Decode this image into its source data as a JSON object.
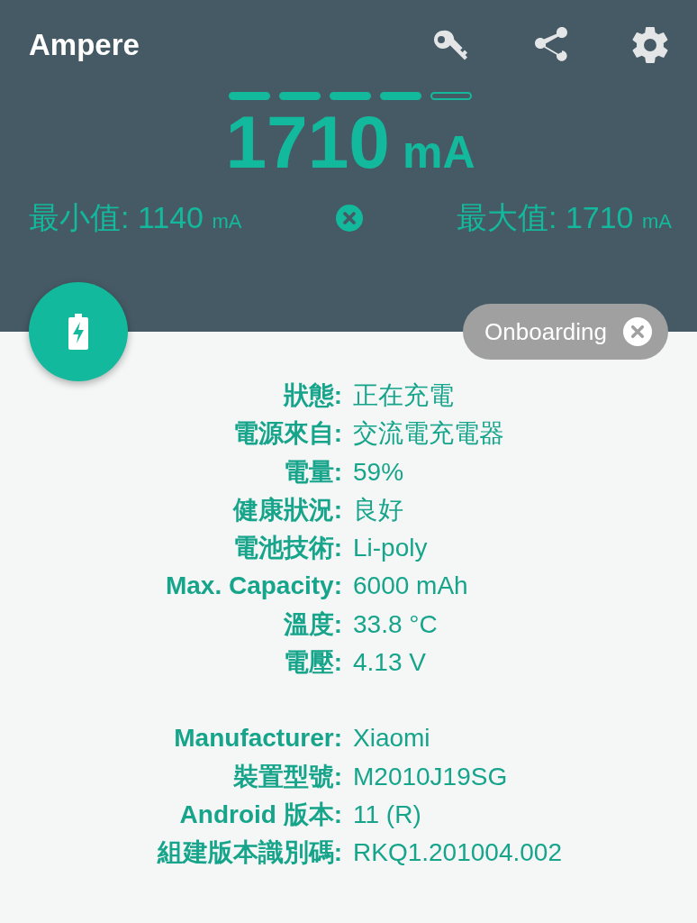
{
  "app_bar": {
    "title": "Ampere"
  },
  "meter": {
    "segments": [
      {
        "on": true
      },
      {
        "on": true
      },
      {
        "on": true
      },
      {
        "on": true
      },
      {
        "on": false
      }
    ],
    "current": "1710",
    "unit": "mA"
  },
  "min": {
    "label": "最小值:",
    "value": "1140",
    "unit": "mA"
  },
  "max": {
    "label": "最大值:",
    "value": "1710",
    "unit": "mA"
  },
  "chip": {
    "label": "Onboarding"
  },
  "battery_info": [
    {
      "label": "狀態:",
      "value": "正在充電"
    },
    {
      "label": "電源來自:",
      "value": "交流電充電器"
    },
    {
      "label": "電量:",
      "value": "59%"
    },
    {
      "label": "健康狀況:",
      "value": "良好"
    },
    {
      "label": "電池技術:",
      "value": "Li-poly"
    },
    {
      "label": "Max. Capacity:",
      "value": "6000 mAh"
    },
    {
      "label": "溫度:",
      "value": "33.8 °C"
    },
    {
      "label": "電壓:",
      "value": "4.13 V"
    }
  ],
  "device_info": [
    {
      "label": "Manufacturer:",
      "value": "Xiaomi"
    },
    {
      "label": "裝置型號:",
      "value": "M2010J19SG"
    },
    {
      "label": "Android 版本:",
      "value": "11 (R)"
    },
    {
      "label": "組建版本識別碼:",
      "value": "RKQ1.201004.002"
    }
  ]
}
